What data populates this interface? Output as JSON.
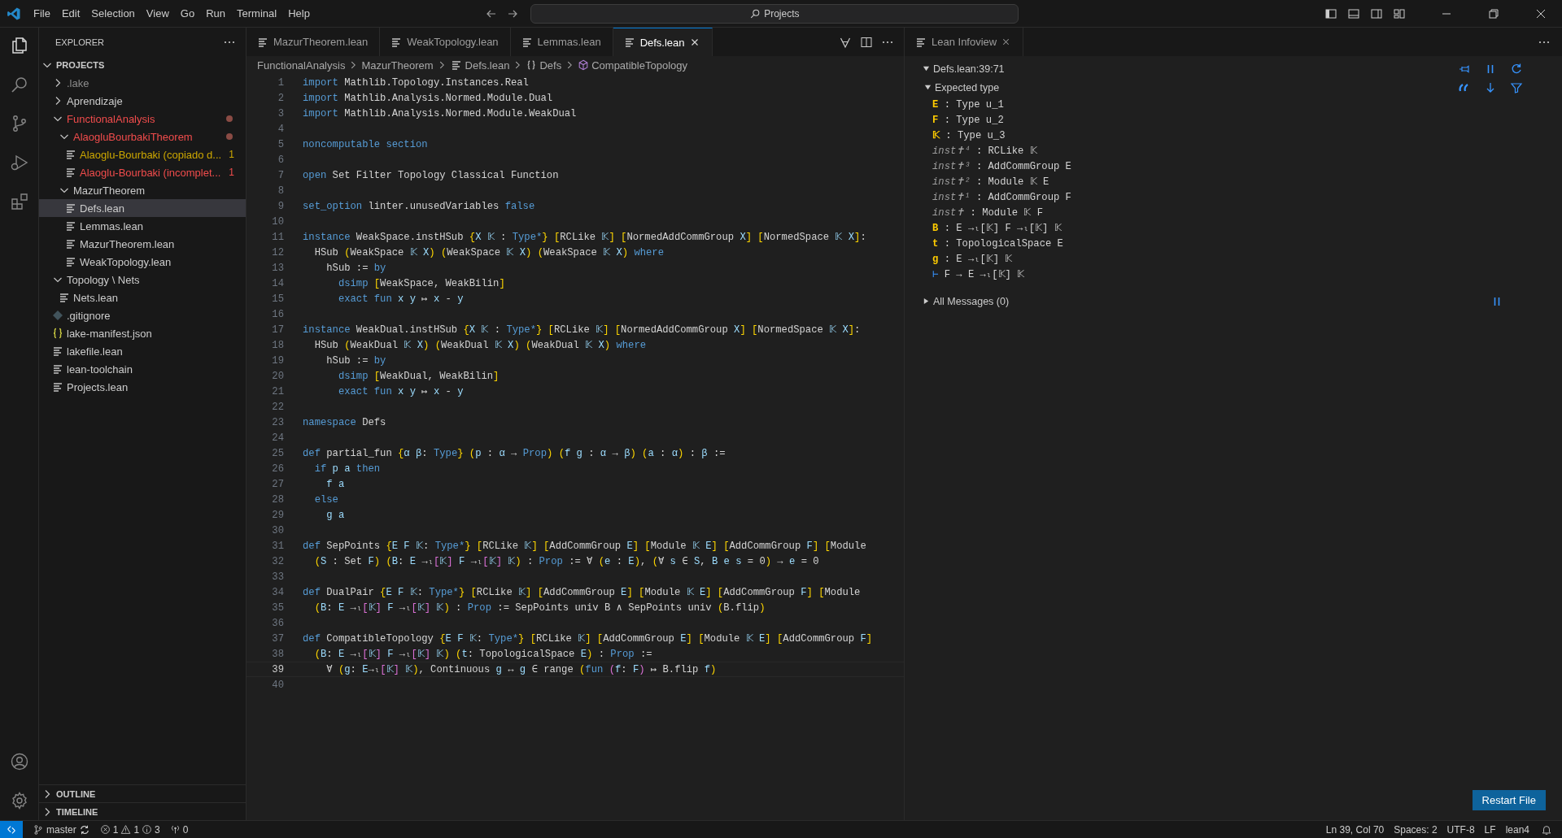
{
  "menu": [
    "File",
    "Edit",
    "Selection",
    "View",
    "Go",
    "Run",
    "Terminal",
    "Help"
  ],
  "search": {
    "value": "Projects"
  },
  "explorer": {
    "title": "EXPLORER",
    "root": {
      "label": "PROJECTS",
      "expanded": true,
      "children": [
        {
          "label": ".lake",
          "kind": "folder",
          "expanded": false,
          "selected": false,
          "color": "#8c8c8c"
        },
        {
          "label": "Aprendizaje",
          "kind": "folder",
          "expanded": false,
          "selected": false,
          "color": "#cccccc"
        },
        {
          "label": "FunctionalAnalysis",
          "kind": "folder",
          "expanded": true,
          "selected": false,
          "color": "#f14c4c",
          "dot": true,
          "children": [
            {
              "label": "AlaogluBourbakiTheorem",
              "kind": "folder",
              "expanded": true,
              "selected": false,
              "color": "#f14c4c",
              "dot": true,
              "children": [
                {
                  "label": "Alaoglu-Bourbaki (copiado d...",
                  "kind": "file",
                  "selected": false,
                  "color": "#cca700",
                  "badge": "1"
                },
                {
                  "label": "Alaoglu-Bourbaki (incomplet...",
                  "kind": "file",
                  "selected": false,
                  "color": "#f14c4c",
                  "badge": "1"
                }
              ]
            },
            {
              "label": "MazurTheorem",
              "kind": "folder",
              "expanded": true,
              "selected": false,
              "color": "#cccccc",
              "children": [
                {
                  "label": "Defs.lean",
                  "kind": "file",
                  "selected": true,
                  "color": "#cccccc"
                },
                {
                  "label": "Lemmas.lean",
                  "kind": "file",
                  "selected": false,
                  "color": "#cccccc"
                },
                {
                  "label": "MazurTheorem.lean",
                  "kind": "file",
                  "selected": false,
                  "color": "#cccccc"
                },
                {
                  "label": "WeakTopology.lean",
                  "kind": "file",
                  "selected": false,
                  "color": "#cccccc"
                }
              ]
            }
          ]
        },
        {
          "label": "Topology \\ Nets",
          "kind": "folder",
          "expanded": true,
          "selected": false,
          "color": "#cccccc",
          "children": [
            {
              "label": "Nets.lean",
              "kind": "file",
              "selected": false,
              "color": "#cccccc"
            }
          ]
        },
        {
          "label": ".gitignore",
          "kind": "gitignore",
          "selected": false,
          "color": "#cccccc"
        },
        {
          "label": "lake-manifest.json",
          "kind": "json",
          "selected": false,
          "color": "#cccccc"
        },
        {
          "label": "lakefile.lean",
          "kind": "file",
          "selected": false,
          "color": "#cccccc"
        },
        {
          "label": "lean-toolchain",
          "kind": "file",
          "selected": false,
          "color": "#cccccc"
        },
        {
          "label": "Projects.lean",
          "kind": "file",
          "selected": false,
          "color": "#cccccc"
        }
      ]
    },
    "sections": [
      {
        "label": "OUTLINE",
        "expanded": false
      },
      {
        "label": "TIMELINE",
        "expanded": false
      }
    ]
  },
  "tabs": [
    {
      "label": "MazurTheorem.lean",
      "selected": false
    },
    {
      "label": "WeakTopology.lean",
      "selected": false
    },
    {
      "label": "Lemmas.lean",
      "selected": false
    },
    {
      "label": "Defs.lean",
      "selected": true
    }
  ],
  "breadcrumbs": [
    {
      "label": "FunctionalAnalysis",
      "kind": "folder"
    },
    {
      "label": "MazurTheorem",
      "kind": "folder"
    },
    {
      "label": "Defs.lean",
      "kind": "file"
    },
    {
      "label": "Defs",
      "kind": "namespace"
    },
    {
      "label": "CompatibleTopology",
      "kind": "symbol"
    }
  ],
  "code": [
    {
      "number": "1",
      "current": false,
      "segments": [
        {
          "kind": "kw",
          "text": "import"
        },
        {
          "kind": "id",
          "text": " Mathlib.Topology.Instances.Real"
        }
      ]
    },
    {
      "number": "2",
      "current": false,
      "segments": [
        {
          "kind": "kw",
          "text": "import"
        },
        {
          "kind": "id",
          "text": " Mathlib.Analysis.Normed.Module.Dual"
        }
      ]
    },
    {
      "number": "3",
      "current": false,
      "segments": [
        {
          "kind": "kw",
          "text": "import"
        },
        {
          "kind": "id",
          "text": " Mathlib.Analysis.Normed.Module.WeakDual"
        }
      ]
    },
    {
      "number": "4",
      "current": false
    },
    {
      "number": "5",
      "current": false,
      "segments": [
        {
          "kind": "kw",
          "text": "noncomputable section"
        }
      ]
    },
    {
      "number": "6",
      "current": false
    },
    {
      "number": "7",
      "current": false,
      "segments": [
        {
          "kind": "kw",
          "text": "open"
        },
        {
          "kind": "id",
          "text": " Set Filter Topology Classical Function"
        }
      ]
    },
    {
      "number": "8",
      "current": false
    },
    {
      "number": "9",
      "current": false,
      "segments": [
        {
          "kind": "kw",
          "text": "set_option"
        },
        {
          "kind": "id",
          "text": " linter.unusedVariables "
        },
        {
          "kind": "kw",
          "text": "false"
        }
      ]
    },
    {
      "number": "10",
      "current": false
    },
    {
      "number": "11",
      "current": false,
      "segments": [
        {
          "kind": "kw",
          "text": "instance"
        },
        {
          "kind": "id",
          "text": " WeakSpace.instHSub "
        },
        {
          "kind": "b1",
          "text": "{"
        },
        {
          "kind": "var",
          "text": "X 𝕂"
        },
        {
          "kind": "id",
          "text": " : "
        },
        {
          "kind": "kw",
          "text": "Type*"
        },
        {
          "kind": "b1",
          "text": "} ["
        },
        {
          "kind": "id",
          "text": "RCLike "
        },
        {
          "kind": "var",
          "text": "𝕂"
        },
        {
          "kind": "b1",
          "text": "] ["
        },
        {
          "kind": "id",
          "text": "NormedAddCommGroup "
        },
        {
          "kind": "var",
          "text": "X"
        },
        {
          "kind": "b1",
          "text": "] ["
        },
        {
          "kind": "id",
          "text": "NormedSpace "
        },
        {
          "kind": "var",
          "text": "𝕂 X"
        },
        {
          "kind": "b1",
          "text": "]"
        },
        {
          "kind": "id",
          "text": ":"
        }
      ]
    },
    {
      "number": "12",
      "current": false,
      "segments": [
        {
          "kind": "id",
          "text": "  HSub "
        },
        {
          "kind": "b1",
          "text": "("
        },
        {
          "kind": "id",
          "text": "WeakSpace "
        },
        {
          "kind": "var",
          "text": "𝕂 X"
        },
        {
          "kind": "b1",
          "text": ") ("
        },
        {
          "kind": "id",
          "text": "WeakSpace "
        },
        {
          "kind": "var",
          "text": "𝕂 X"
        },
        {
          "kind": "b1",
          "text": ") ("
        },
        {
          "kind": "id",
          "text": "WeakSpace "
        },
        {
          "kind": "var",
          "text": "𝕂 X"
        },
        {
          "kind": "b1",
          "text": ")"
        },
        {
          "kind": "kw",
          "text": " where"
        }
      ]
    },
    {
      "number": "13",
      "current": false,
      "segments": [
        {
          "kind": "id",
          "text": "    hSub := "
        },
        {
          "kind": "kw",
          "text": "by"
        }
      ]
    },
    {
      "number": "14",
      "current": false,
      "segments": [
        {
          "kind": "kw",
          "text": "      dsimp "
        },
        {
          "kind": "b1",
          "text": "["
        },
        {
          "kind": "id",
          "text": "WeakSpace, WeakBilin"
        },
        {
          "kind": "b1",
          "text": "]"
        }
      ]
    },
    {
      "number": "15",
      "current": false,
      "segments": [
        {
          "kind": "kw",
          "text": "      exact fun"
        },
        {
          "kind": "var",
          "text": " x y"
        },
        {
          "kind": "id",
          "text": " ↦ "
        },
        {
          "kind": "var",
          "text": "x"
        },
        {
          "kind": "id",
          "text": " - "
        },
        {
          "kind": "var",
          "text": "y"
        }
      ]
    },
    {
      "number": "16",
      "current": false
    },
    {
      "number": "17",
      "current": false,
      "segments": [
        {
          "kind": "kw",
          "text": "instance"
        },
        {
          "kind": "id",
          "text": " WeakDual.instHSub "
        },
        {
          "kind": "b1",
          "text": "{"
        },
        {
          "kind": "var",
          "text": "X 𝕂"
        },
        {
          "kind": "id",
          "text": " : "
        },
        {
          "kind": "kw",
          "text": "Type*"
        },
        {
          "kind": "b1",
          "text": "} ["
        },
        {
          "kind": "id",
          "text": "RCLike "
        },
        {
          "kind": "var",
          "text": "𝕂"
        },
        {
          "kind": "b1",
          "text": "] ["
        },
        {
          "kind": "id",
          "text": "NormedAddCommGroup "
        },
        {
          "kind": "var",
          "text": "X"
        },
        {
          "kind": "b1",
          "text": "] ["
        },
        {
          "kind": "id",
          "text": "NormedSpace "
        },
        {
          "kind": "var",
          "text": "𝕂 X"
        },
        {
          "kind": "b1",
          "text": "]"
        },
        {
          "kind": "id",
          "text": ":"
        }
      ]
    },
    {
      "number": "18",
      "current": false,
      "segments": [
        {
          "kind": "id",
          "text": "  HSub "
        },
        {
          "kind": "b1",
          "text": "("
        },
        {
          "kind": "id",
          "text": "WeakDual "
        },
        {
          "kind": "var",
          "text": "𝕂 X"
        },
        {
          "kind": "b1",
          "text": ") ("
        },
        {
          "kind": "id",
          "text": "WeakDual "
        },
        {
          "kind": "var",
          "text": "𝕂 X"
        },
        {
          "kind": "b1",
          "text": ") ("
        },
        {
          "kind": "id",
          "text": "WeakDual "
        },
        {
          "kind": "var",
          "text": "𝕂 X"
        },
        {
          "kind": "b1",
          "text": ")"
        },
        {
          "kind": "kw",
          "text": " where"
        }
      ]
    },
    {
      "number": "19",
      "current": false,
      "segments": [
        {
          "kind": "id",
          "text": "    hSub := "
        },
        {
          "kind": "kw",
          "text": "by"
        }
      ]
    },
    {
      "number": "20",
      "current": false,
      "segments": [
        {
          "kind": "kw",
          "text": "      dsimp "
        },
        {
          "kind": "b1",
          "text": "["
        },
        {
          "kind": "id",
          "text": "WeakDual, WeakBilin"
        },
        {
          "kind": "b1",
          "text": "]"
        }
      ]
    },
    {
      "number": "21",
      "current": false,
      "segments": [
        {
          "kind": "kw",
          "text": "      exact fun"
        },
        {
          "kind": "var",
          "text": " x y"
        },
        {
          "kind": "id",
          "text": " ↦ "
        },
        {
          "kind": "var",
          "text": "x"
        },
        {
          "kind": "id",
          "text": " - "
        },
        {
          "kind": "var",
          "text": "y"
        }
      ]
    },
    {
      "number": "22",
      "current": false
    },
    {
      "number": "23",
      "current": false,
      "segments": [
        {
          "kind": "kw",
          "text": "namespace"
        },
        {
          "kind": "id",
          "text": " Defs"
        }
      ]
    },
    {
      "number": "24",
      "current": false
    },
    {
      "number": "25",
      "current": false,
      "segments": [
        {
          "kind": "kw",
          "text": "def"
        },
        {
          "kind": "id",
          "text": " partial_fun "
        },
        {
          "kind": "b1",
          "text": "{"
        },
        {
          "kind": "var",
          "text": "α β"
        },
        {
          "kind": "id",
          "text": ": "
        },
        {
          "kind": "kw",
          "text": "Type"
        },
        {
          "kind": "b1",
          "text": "} ("
        },
        {
          "kind": "var",
          "text": "p"
        },
        {
          "kind": "id",
          "text": " : "
        },
        {
          "kind": "var",
          "text": "α"
        },
        {
          "kind": "id",
          "text": " → "
        },
        {
          "kind": "kw",
          "text": "Prop"
        },
        {
          "kind": "b1",
          "text": ") ("
        },
        {
          "kind": "var",
          "text": "f g"
        },
        {
          "kind": "id",
          "text": " : "
        },
        {
          "kind": "var",
          "text": "α"
        },
        {
          "kind": "id",
          "text": " → "
        },
        {
          "kind": "var",
          "text": "β"
        },
        {
          "kind": "b1",
          "text": ") ("
        },
        {
          "kind": "var",
          "text": "a"
        },
        {
          "kind": "id",
          "text": " : "
        },
        {
          "kind": "var",
          "text": "α"
        },
        {
          "kind": "b1",
          "text": ")"
        },
        {
          "kind": "id",
          "text": " : "
        },
        {
          "kind": "var",
          "text": "β"
        },
        {
          "kind": "id",
          "text": " :="
        }
      ]
    },
    {
      "number": "26",
      "current": false,
      "segments": [
        {
          "kind": "kw",
          "text": "  if"
        },
        {
          "kind": "var",
          "text": " p a"
        },
        {
          "kind": "kw",
          "text": " then"
        }
      ]
    },
    {
      "number": "27",
      "current": false,
      "segments": [
        {
          "kind": "var",
          "text": "    f a"
        }
      ]
    },
    {
      "number": "28",
      "current": false,
      "segments": [
        {
          "kind": "kw",
          "text": "  else"
        }
      ]
    },
    {
      "number": "29",
      "current": false,
      "segments": [
        {
          "kind": "var",
          "text": "    g a"
        }
      ]
    },
    {
      "number": "30",
      "current": false
    },
    {
      "number": "31",
      "current": false,
      "segments": [
        {
          "kind": "kw",
          "text": "def"
        },
        {
          "kind": "id",
          "text": " SepPoints "
        },
        {
          "kind": "b1",
          "text": "{"
        },
        {
          "kind": "var",
          "text": "E F 𝕂"
        },
        {
          "kind": "id",
          "text": ": "
        },
        {
          "kind": "kw",
          "text": "Type*"
        },
        {
          "kind": "b1",
          "text": "} ["
        },
        {
          "kind": "id",
          "text": "RCLike "
        },
        {
          "kind": "var",
          "text": "𝕂"
        },
        {
          "kind": "b1",
          "text": "] ["
        },
        {
          "kind": "id",
          "text": "AddCommGroup "
        },
        {
          "kind": "var",
          "text": "E"
        },
        {
          "kind": "b1",
          "text": "] ["
        },
        {
          "kind": "id",
          "text": "Module "
        },
        {
          "kind": "var",
          "text": "𝕂 E"
        },
        {
          "kind": "b1",
          "text": "] ["
        },
        {
          "kind": "id",
          "text": "AddCommGroup "
        },
        {
          "kind": "var",
          "text": "F"
        },
        {
          "kind": "b1",
          "text": "] ["
        },
        {
          "kind": "id",
          "text": "Module"
        }
      ]
    },
    {
      "number": "32",
      "current": false,
      "segments": [
        {
          "kind": "b1",
          "text": "  ("
        },
        {
          "kind": "var",
          "text": "S"
        },
        {
          "kind": "id",
          "text": " : Set "
        },
        {
          "kind": "var",
          "text": "F"
        },
        {
          "kind": "b1",
          "text": ") ("
        },
        {
          "kind": "var",
          "text": "B"
        },
        {
          "kind": "id",
          "text": ": "
        },
        {
          "kind": "var",
          "text": "E"
        },
        {
          "kind": "id",
          "text": " →ₗ"
        },
        {
          "kind": "b2",
          "text": "["
        },
        {
          "kind": "var",
          "text": "𝕂"
        },
        {
          "kind": "b2",
          "text": "] "
        },
        {
          "kind": "var",
          "text": "F"
        },
        {
          "kind": "id",
          "text": " →ₗ"
        },
        {
          "kind": "b2",
          "text": "["
        },
        {
          "kind": "var",
          "text": "𝕂"
        },
        {
          "kind": "b2",
          "text": "] "
        },
        {
          "kind": "var",
          "text": "𝕂"
        },
        {
          "kind": "b1",
          "text": ")"
        },
        {
          "kind": "id",
          "text": " : "
        },
        {
          "kind": "kw",
          "text": "Prop"
        },
        {
          "kind": "id",
          "text": " := ∀ "
        },
        {
          "kind": "b1",
          "text": "("
        },
        {
          "kind": "var",
          "text": "e"
        },
        {
          "kind": "id",
          "text": " : "
        },
        {
          "kind": "var",
          "text": "E"
        },
        {
          "kind": "b1",
          "text": ")"
        },
        {
          "kind": "id",
          "text": ", "
        },
        {
          "kind": "b1",
          "text": "("
        },
        {
          "kind": "id",
          "text": "∀ "
        },
        {
          "kind": "var",
          "text": "s"
        },
        {
          "kind": "id",
          "text": " ∈ "
        },
        {
          "kind": "var",
          "text": "S"
        },
        {
          "kind": "id",
          "text": ", "
        },
        {
          "kind": "var",
          "text": "B e s"
        },
        {
          "kind": "id",
          "text": " = 0"
        },
        {
          "kind": "b1",
          "text": ")"
        },
        {
          "kind": "id",
          "text": " → "
        },
        {
          "kind": "var",
          "text": "e"
        },
        {
          "kind": "id",
          "text": " = 0"
        }
      ]
    },
    {
      "number": "33",
      "current": false
    },
    {
      "number": "34",
      "current": false,
      "segments": [
        {
          "kind": "kw",
          "text": "def"
        },
        {
          "kind": "id",
          "text": " DualPair "
        },
        {
          "kind": "b1",
          "text": "{"
        },
        {
          "kind": "var",
          "text": "E F 𝕂"
        },
        {
          "kind": "id",
          "text": ": "
        },
        {
          "kind": "kw",
          "text": "Type*"
        },
        {
          "kind": "b1",
          "text": "} ["
        },
        {
          "kind": "id",
          "text": "RCLike "
        },
        {
          "kind": "var",
          "text": "𝕂"
        },
        {
          "kind": "b1",
          "text": "] ["
        },
        {
          "kind": "id",
          "text": "AddCommGroup "
        },
        {
          "kind": "var",
          "text": "E"
        },
        {
          "kind": "b1",
          "text": "] ["
        },
        {
          "kind": "id",
          "text": "Module "
        },
        {
          "kind": "var",
          "text": "𝕂 E"
        },
        {
          "kind": "b1",
          "text": "] ["
        },
        {
          "kind": "id",
          "text": "AddCommGroup "
        },
        {
          "kind": "var",
          "text": "F"
        },
        {
          "kind": "b1",
          "text": "] ["
        },
        {
          "kind": "id",
          "text": "Module"
        }
      ]
    },
    {
      "number": "35",
      "current": false,
      "segments": [
        {
          "kind": "b1",
          "text": "  ("
        },
        {
          "kind": "var",
          "text": "B"
        },
        {
          "kind": "id",
          "text": ": "
        },
        {
          "kind": "var",
          "text": "E"
        },
        {
          "kind": "id",
          "text": " →ₗ"
        },
        {
          "kind": "b2",
          "text": "["
        },
        {
          "kind": "var",
          "text": "𝕂"
        },
        {
          "kind": "b2",
          "text": "] "
        },
        {
          "kind": "var",
          "text": "F"
        },
        {
          "kind": "id",
          "text": " →ₗ"
        },
        {
          "kind": "b2",
          "text": "["
        },
        {
          "kind": "var",
          "text": "𝕂"
        },
        {
          "kind": "b2",
          "text": "] "
        },
        {
          "kind": "var",
          "text": "𝕂"
        },
        {
          "kind": "b1",
          "text": ")"
        },
        {
          "kind": "id",
          "text": " : "
        },
        {
          "kind": "kw",
          "text": "Prop"
        },
        {
          "kind": "id",
          "text": " := SepPoints univ B ∧ SepPoints univ "
        },
        {
          "kind": "b1",
          "text": "("
        },
        {
          "kind": "id",
          "text": "B.flip"
        },
        {
          "kind": "b1",
          "text": ")"
        }
      ]
    },
    {
      "number": "36",
      "current": false
    },
    {
      "number": "37",
      "current": false,
      "segments": [
        {
          "kind": "kw",
          "text": "def"
        },
        {
          "kind": "id",
          "text": " CompatibleTopology "
        },
        {
          "kind": "b1",
          "text": "{"
        },
        {
          "kind": "var",
          "text": "E F 𝕂"
        },
        {
          "kind": "id",
          "text": ": "
        },
        {
          "kind": "kw",
          "text": "Type*"
        },
        {
          "kind": "b1",
          "text": "} ["
        },
        {
          "kind": "id",
          "text": "RCLike "
        },
        {
          "kind": "var",
          "text": "𝕂"
        },
        {
          "kind": "b1",
          "text": "] ["
        },
        {
          "kind": "id",
          "text": "AddCommGroup "
        },
        {
          "kind": "var",
          "text": "E"
        },
        {
          "kind": "b1",
          "text": "] ["
        },
        {
          "kind": "id",
          "text": "Module "
        },
        {
          "kind": "var",
          "text": "𝕂 E"
        },
        {
          "kind": "b1",
          "text": "] ["
        },
        {
          "kind": "id",
          "text": "AddCommGroup "
        },
        {
          "kind": "var",
          "text": "F"
        },
        {
          "kind": "b1",
          "text": "]"
        }
      ]
    },
    {
      "number": "38",
      "current": false,
      "segments": [
        {
          "kind": "b1",
          "text": "  ("
        },
        {
          "kind": "var",
          "text": "B"
        },
        {
          "kind": "id",
          "text": ": "
        },
        {
          "kind": "var",
          "text": "E"
        },
        {
          "kind": "id",
          "text": " →ₗ"
        },
        {
          "kind": "b2",
          "text": "["
        },
        {
          "kind": "var",
          "text": "𝕂"
        },
        {
          "kind": "b2",
          "text": "] "
        },
        {
          "kind": "var",
          "text": "F"
        },
        {
          "kind": "id",
          "text": " →ₗ"
        },
        {
          "kind": "b2",
          "text": "["
        },
        {
          "kind": "var",
          "text": "𝕂"
        },
        {
          "kind": "b2",
          "text": "] "
        },
        {
          "kind": "var",
          "text": "𝕂"
        },
        {
          "kind": "b1",
          "text": ") ("
        },
        {
          "kind": "var",
          "text": "t"
        },
        {
          "kind": "id",
          "text": ": TopologicalSpace "
        },
        {
          "kind": "var",
          "text": "E"
        },
        {
          "kind": "b1",
          "text": ")"
        },
        {
          "kind": "id",
          "text": " : "
        },
        {
          "kind": "kw",
          "text": "Prop"
        },
        {
          "kind": "id",
          "text": " :="
        }
      ]
    },
    {
      "number": "39",
      "current": true,
      "segments": [
        {
          "kind": "id",
          "text": "    ∀ "
        },
        {
          "kind": "b1",
          "text": "("
        },
        {
          "kind": "var",
          "text": "g"
        },
        {
          "kind": "id",
          "text": ": "
        },
        {
          "kind": "var",
          "text": "E"
        },
        {
          "kind": "id",
          "text": "→ₗ"
        },
        {
          "kind": "b2",
          "text": "["
        },
        {
          "kind": "var",
          "text": "𝕂"
        },
        {
          "kind": "b2",
          "text": "] "
        },
        {
          "kind": "var",
          "text": "𝕂"
        },
        {
          "kind": "b1",
          "text": ")"
        },
        {
          "kind": "id",
          "text": ", Continuous "
        },
        {
          "kind": "var",
          "text": "g"
        },
        {
          "kind": "id",
          "text": " ↔ "
        },
        {
          "kind": "var",
          "text": "g"
        },
        {
          "kind": "id",
          "text": " ∈ range "
        },
        {
          "kind": "b1",
          "text": "("
        },
        {
          "kind": "kw",
          "text": "fun "
        },
        {
          "kind": "b2",
          "text": "("
        },
        {
          "kind": "var",
          "text": "f"
        },
        {
          "kind": "id",
          "text": ": "
        },
        {
          "kind": "var",
          "text": "F"
        },
        {
          "kind": "b2",
          "text": ")"
        },
        {
          "kind": "id",
          "text": " ↦ B.flip "
        },
        {
          "kind": "var",
          "text": "f"
        },
        {
          "kind": "b1",
          "text": ")"
        }
      ]
    },
    {
      "number": "40",
      "current": false
    }
  ],
  "infoview": {
    "tab": "Lean Infoview",
    "position": {
      "label": "Defs.lean:39:71",
      "expanded": true
    },
    "goal_section": {
      "label": "Expected type",
      "expanded": true
    },
    "hypotheses": [
      {
        "kind": "var",
        "name": "E",
        "type_text": ": Type u_1"
      },
      {
        "kind": "var",
        "name": "F",
        "type_text": ": Type u_2"
      },
      {
        "kind": "var",
        "name": "𝕂",
        "type_text": ": Type u_3"
      },
      {
        "kind": "inst",
        "name": "inst✝⁴",
        "type_text": ": RCLike 𝕂"
      },
      {
        "kind": "inst",
        "name": "inst✝³",
        "type_text": ": AddCommGroup E"
      },
      {
        "kind": "inst",
        "name": "inst✝²",
        "type_text": ": Module 𝕂 E"
      },
      {
        "kind": "inst",
        "name": "inst✝¹",
        "type_text": ": AddCommGroup F"
      },
      {
        "kind": "inst",
        "name": "inst✝",
        "type_text": ": Module 𝕂 F"
      },
      {
        "kind": "var",
        "name": "B",
        "type_text": ": E →ₗ[𝕂] F →ₗ[𝕂] 𝕂"
      },
      {
        "kind": "var",
        "name": "t",
        "type_text": ": TopologicalSpace E"
      },
      {
        "kind": "var",
        "name": "g",
        "type_text": ": E →ₗ[𝕂] 𝕂"
      },
      {
        "kind": "goal",
        "name": "⊢",
        "type_text": "F → E →ₗ[𝕂] 𝕂"
      }
    ],
    "messages": {
      "label": "All Messages (0)",
      "expanded": false
    },
    "restart_button": "Restart File"
  },
  "status_bar": {
    "branch": "master",
    "errors": "1",
    "warnings": "1",
    "infos": "3",
    "ports": "0",
    "right": [
      "Ln 39, Col 70",
      "Spaces: 2",
      "UTF-8",
      "LF",
      "lean4"
    ]
  }
}
